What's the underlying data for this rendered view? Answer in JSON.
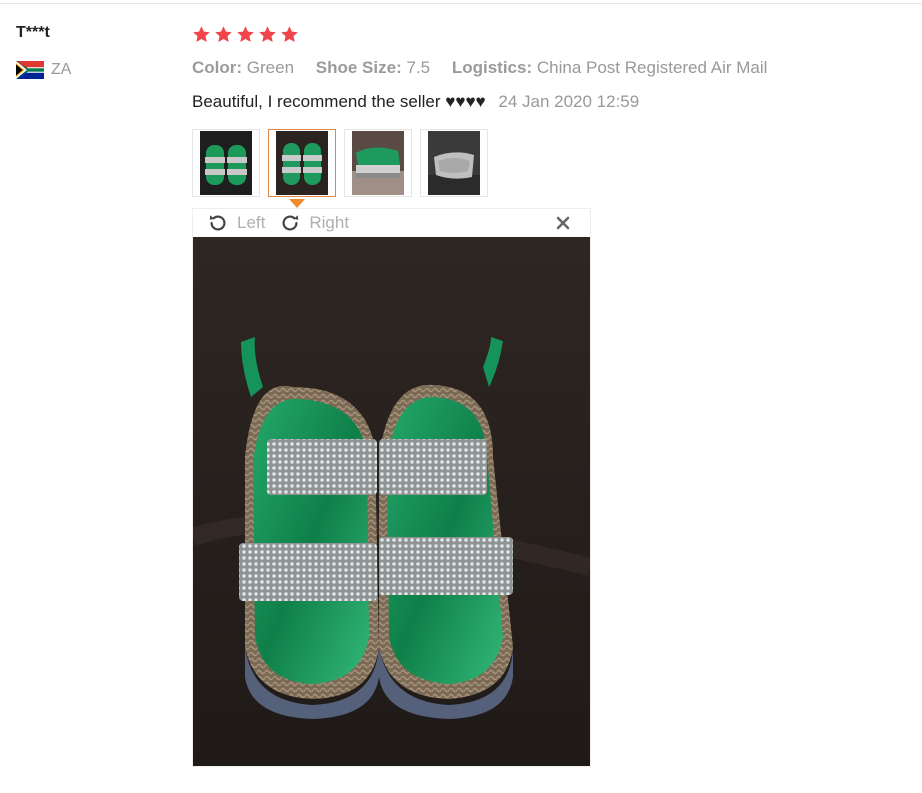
{
  "user": {
    "name": "T***t",
    "country_code": "ZA",
    "flag_icon": "south-africa-flag-icon"
  },
  "rating": {
    "stars": 5,
    "max": 5,
    "color": "#f0454b"
  },
  "attributes": [
    {
      "label": "Color:",
      "value": "Green"
    },
    {
      "label": "Shoe Size:",
      "value": "7.5"
    },
    {
      "label": "Logistics:",
      "value": "China Post Registered Air Mail"
    }
  ],
  "review": {
    "text": "Beautiful, I recommend the seller",
    "hearts": "♥♥♥♥",
    "date": "24 Jan 2020 12:59"
  },
  "thumbnails": [
    {
      "name": "review-photo-1"
    },
    {
      "name": "review-photo-2",
      "active": true
    },
    {
      "name": "review-photo-3"
    },
    {
      "name": "review-photo-4"
    }
  ],
  "viewer": {
    "rotate_left_label": "Left",
    "rotate_right_label": "Right",
    "close_icon": "close-icon",
    "accent_color": "#f08a2d"
  }
}
